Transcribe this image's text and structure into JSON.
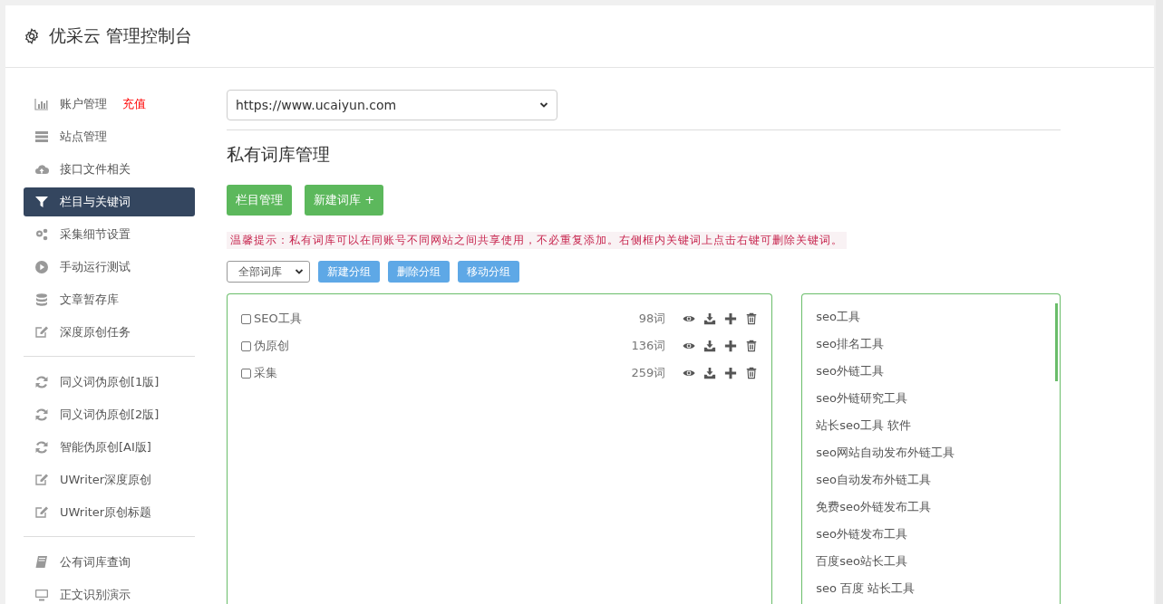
{
  "header": {
    "title": "优采云 管理控制台"
  },
  "sidebar": {
    "groups": [
      {
        "items": [
          {
            "kind": "chart",
            "label": "账户管理",
            "badge": "充值",
            "selected": false
          },
          {
            "kind": "server",
            "label": "站点管理",
            "selected": false
          },
          {
            "kind": "cloud",
            "label": "接口文件相关",
            "selected": false
          },
          {
            "kind": "filter",
            "label": "栏目与关键词",
            "selected": true
          },
          {
            "kind": "gears",
            "label": "采集细节设置",
            "selected": false
          },
          {
            "kind": "play",
            "label": "手动运行测试",
            "selected": false
          },
          {
            "kind": "database",
            "label": "文章暂存库",
            "selected": false
          },
          {
            "kind": "edit",
            "label": "深度原创任务",
            "selected": false
          }
        ]
      },
      {
        "items": [
          {
            "kind": "refresh",
            "label": "同义词伪原创[1版]",
            "selected": false
          },
          {
            "kind": "refresh",
            "label": "同义词伪原创[2版]",
            "selected": false
          },
          {
            "kind": "refresh",
            "label": "智能伪原创[AI版]",
            "selected": false
          },
          {
            "kind": "edit",
            "label": "UWriter深度原创",
            "selected": false
          },
          {
            "kind": "edit",
            "label": "UWriter原创标题",
            "selected": false
          }
        ]
      },
      {
        "items": [
          {
            "kind": "book",
            "label": "公有词库查询",
            "selected": false
          },
          {
            "kind": "monitor",
            "label": "正文识别演示",
            "selected": false
          }
        ]
      }
    ]
  },
  "site_select": {
    "value": "https://www.ucaiyun.com"
  },
  "page_title": "私有词库管理",
  "action_buttons": [
    "栏目管理",
    "新建词库 +"
  ],
  "tip": "温馨提示：私有词库可以在同账号不同网站之间共享使用，不必重复添加。右侧框内关键词上点击右键可删除关键词。",
  "group_select": {
    "value": "全部词库"
  },
  "group_buttons": [
    "新建分组",
    "删除分组",
    "移动分组"
  ],
  "libraries": [
    {
      "name": "SEO工具",
      "count": "98词",
      "checked": false
    },
    {
      "name": "伪原创",
      "count": "136词",
      "checked": false
    },
    {
      "name": "采集",
      "count": "259词",
      "checked": false
    }
  ],
  "keywords": [
    "seo工具",
    "seo排名工具",
    "seo外链工具",
    "seo外链研究工具",
    "站长seo工具 软件",
    "seo网站自动发布外链工具",
    "seo自动发布外链工具",
    "免费seo外链发布工具",
    "seo外链发布工具",
    "百度seo站长工具",
    "seo 百度 站长工具"
  ]
}
